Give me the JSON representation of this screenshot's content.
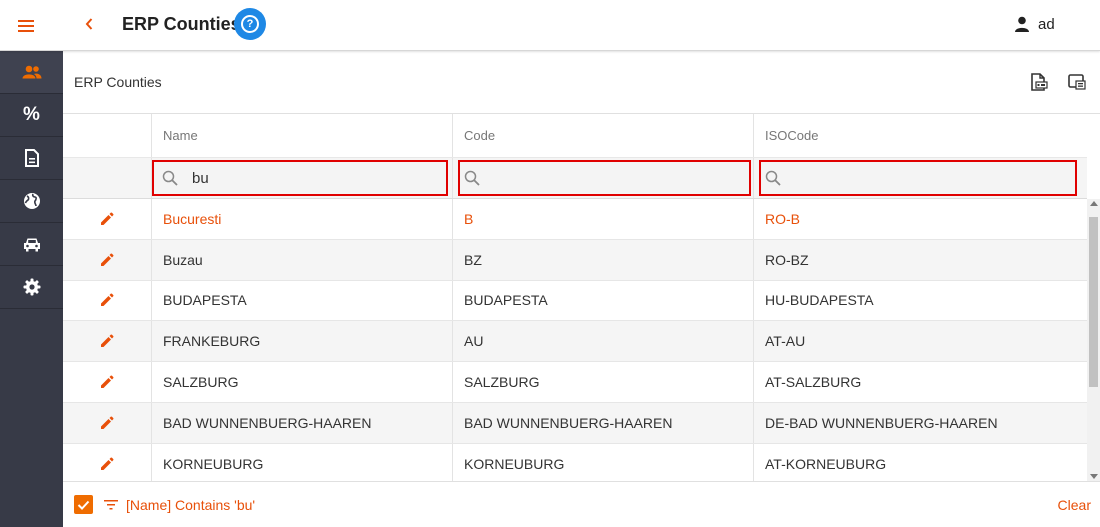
{
  "header": {
    "title": "ERP Counties",
    "help_label": "?",
    "user_name": "ad"
  },
  "sidebar": {
    "items": [
      {
        "icon": "users-icon",
        "active": true
      },
      {
        "icon": "percent-icon",
        "label": "%"
      },
      {
        "icon": "document-icon"
      },
      {
        "icon": "globe-icon"
      },
      {
        "icon": "car-icon"
      },
      {
        "icon": "gear-icon"
      }
    ]
  },
  "panel": {
    "title": "ERP Counties"
  },
  "grid": {
    "columns": [
      "Name",
      "Code",
      "ISOCode"
    ],
    "filters": {
      "name": "bu",
      "code": "",
      "iso": ""
    },
    "rows": [
      {
        "name": "Bucuresti",
        "code": "B",
        "iso": "RO-B",
        "selected": true
      },
      {
        "name": "Buzau",
        "code": "BZ",
        "iso": "RO-BZ"
      },
      {
        "name": "BUDAPESTA",
        "code": "BUDAPESTA",
        "iso": "HU-BUDAPESTA"
      },
      {
        "name": "FRANKEBURG",
        "code": "AU",
        "iso": "AT-AU"
      },
      {
        "name": "SALZBURG",
        "code": "SALZBURG",
        "iso": "AT-SALZBURG"
      },
      {
        "name": "BAD WUNNENBUERG-HAAREN",
        "code": "BAD WUNNENBUERG-HAAREN",
        "iso": "DE-BAD WUNNENBUERG-HAAREN"
      },
      {
        "name": "KORNEUBURG",
        "code": "KORNEUBURG",
        "iso": "AT-KORNEUBURG"
      }
    ]
  },
  "footer": {
    "filter_text": "[Name] Contains 'bu'",
    "clear_label": "Clear"
  },
  "colors": {
    "accent": "#e8500a",
    "sidebar": "#373a47",
    "help": "#1e88e5",
    "highlight_border": "#e00000"
  }
}
